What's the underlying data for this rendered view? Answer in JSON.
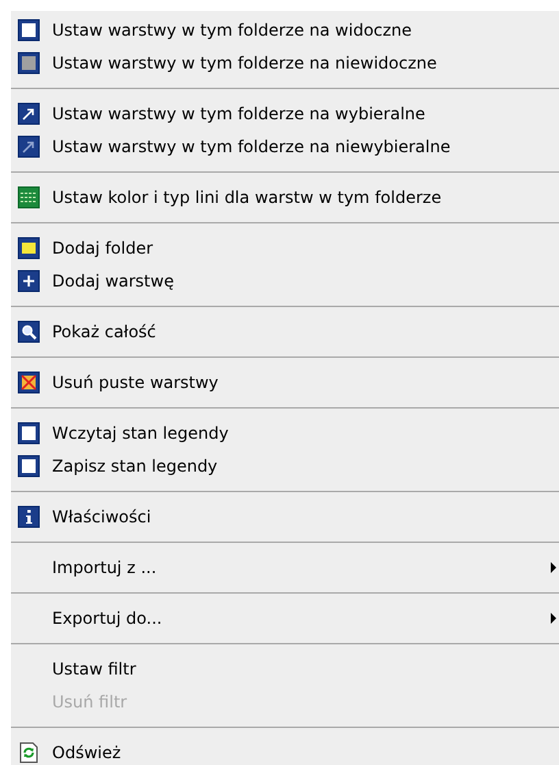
{
  "menu": {
    "groups": [
      {
        "items": [
          {
            "kind": "square-white",
            "label": "Ustaw warstwy w tym folderze na widoczne",
            "disabled": false,
            "submenu": false
          },
          {
            "kind": "square-gray",
            "label": "Ustaw warstwy w tym folderze na niewidoczne",
            "disabled": false,
            "submenu": false
          }
        ]
      },
      {
        "items": [
          {
            "kind": "arrow",
            "label": "Ustaw warstwy w tym folderze na wybieralne",
            "disabled": false,
            "submenu": false
          },
          {
            "kind": "arrow-dim",
            "label": "Ustaw warstwy w tym folderze na niewybieralne",
            "disabled": false,
            "submenu": false
          }
        ]
      },
      {
        "items": [
          {
            "kind": "grid",
            "label": "Ustaw kolor i typ lini dla warstw w tym folderze",
            "disabled": false,
            "submenu": false
          }
        ]
      },
      {
        "items": [
          {
            "kind": "square-yellow",
            "label": "Dodaj folder",
            "disabled": false,
            "submenu": false
          },
          {
            "kind": "plus",
            "label": "Dodaj warstwę",
            "disabled": false,
            "submenu": false
          }
        ]
      },
      {
        "items": [
          {
            "kind": "magnifier",
            "label": "Pokaż całość",
            "disabled": false,
            "submenu": false
          }
        ]
      },
      {
        "items": [
          {
            "kind": "cross",
            "label": "Usuń puste warstwy",
            "disabled": false,
            "submenu": false
          }
        ]
      },
      {
        "items": [
          {
            "kind": "square-white",
            "label": "Wczytaj stan legendy",
            "disabled": false,
            "submenu": false
          },
          {
            "kind": "square-white",
            "label": "Zapisz stan legendy",
            "disabled": false,
            "submenu": false
          }
        ]
      },
      {
        "items": [
          {
            "kind": "info",
            "label": "Właściwości",
            "disabled": false,
            "submenu": false
          }
        ]
      },
      {
        "items": [
          {
            "kind": "none",
            "label": "Importuj z ...",
            "disabled": false,
            "submenu": true
          }
        ]
      },
      {
        "items": [
          {
            "kind": "none",
            "label": "Exportuj do...",
            "disabled": false,
            "submenu": true
          }
        ]
      },
      {
        "items": [
          {
            "kind": "none",
            "label": "Ustaw filtr",
            "disabled": false,
            "submenu": false
          },
          {
            "kind": "none",
            "label": "Usuń filtr",
            "disabled": true,
            "submenu": false
          }
        ]
      },
      {
        "items": [
          {
            "kind": "refresh",
            "label": "Odśwież",
            "disabled": false,
            "submenu": false
          }
        ]
      }
    ]
  }
}
